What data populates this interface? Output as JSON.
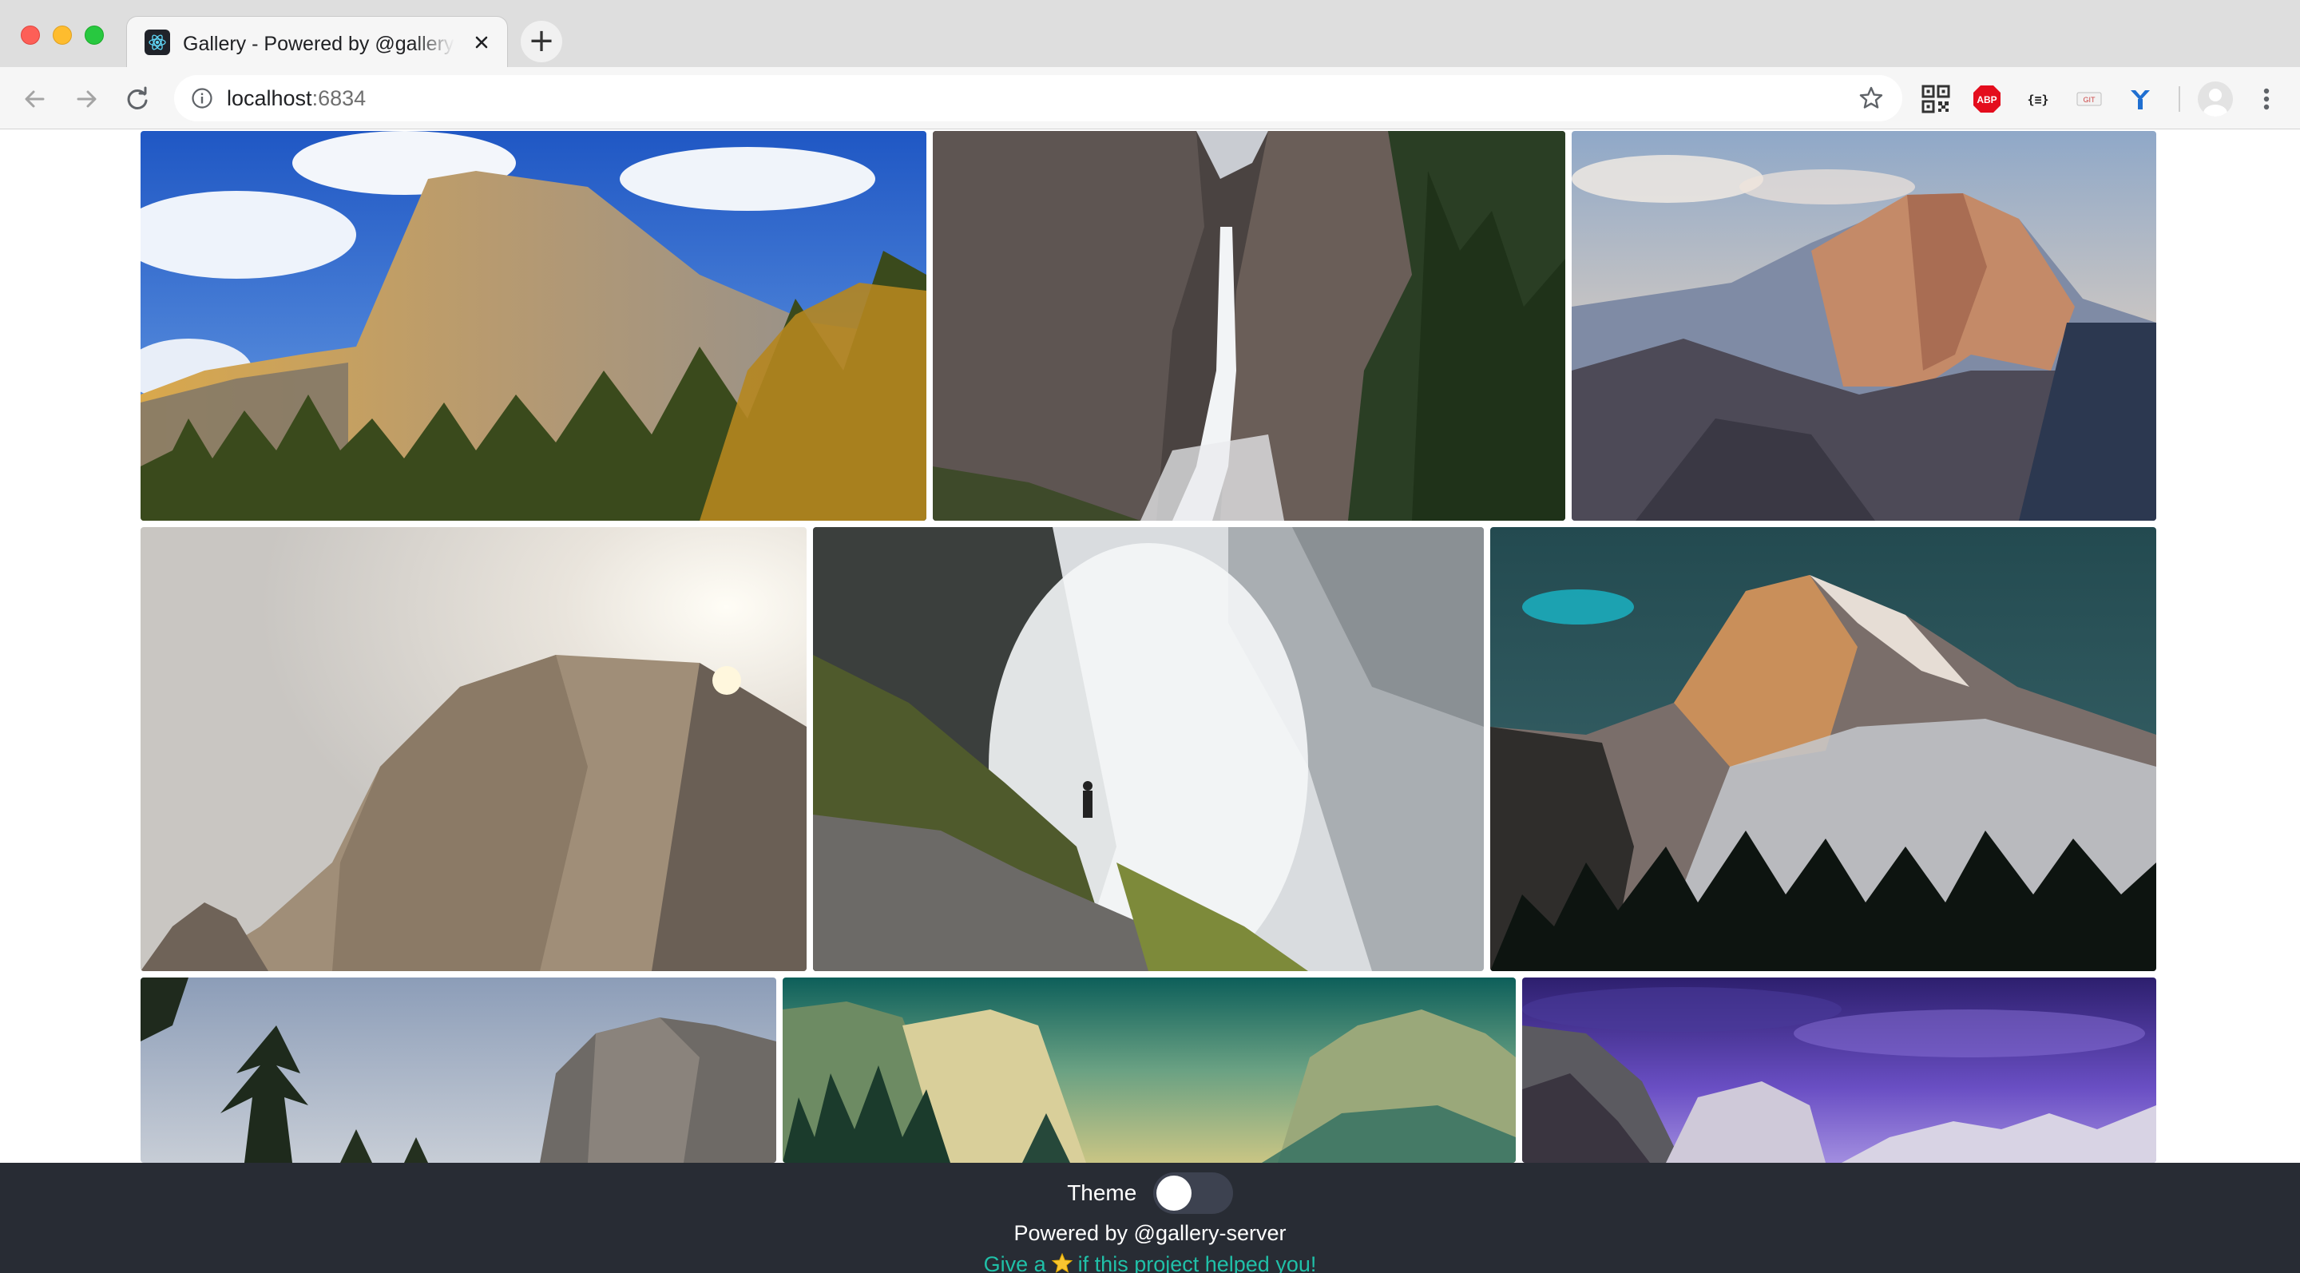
{
  "browser": {
    "tab_title": "Gallery - Powered by @gallery-server",
    "new_tab_symbol": "+",
    "url_host": "localhost",
    "url_port": ":6834",
    "icons": {
      "back": "arrow-left-icon",
      "forward": "arrow-right-icon",
      "reload": "reload-icon",
      "info": "info-icon",
      "bookmark": "star-icon",
      "menu": "kebab-menu-icon"
    },
    "extensions": [
      "qr-code-icon",
      "adblock-plus-icon",
      "json-viewer-icon",
      "git-icon",
      "y-extension-icon"
    ]
  },
  "gallery": {
    "photos": [
      {
        "subject": "el-capitan-blue-sky"
      },
      {
        "subject": "yosemite-falls"
      },
      {
        "subject": "half-dome-sunset"
      },
      {
        "subject": "half-dome-sunburst"
      },
      {
        "subject": "mist-trail-waterfall"
      },
      {
        "subject": "half-dome-snow-teal-sky"
      },
      {
        "subject": "el-capitan-pines"
      },
      {
        "subject": "valley-teal-mist"
      },
      {
        "subject": "valley-purple-sky"
      }
    ]
  },
  "footer": {
    "theme_label": "Theme",
    "powered_by": "Powered by @gallery-server",
    "cta_before": "Give a",
    "cta_after": "if this project helped you!",
    "background": "#282c34",
    "link_color": "#20c0a8"
  }
}
